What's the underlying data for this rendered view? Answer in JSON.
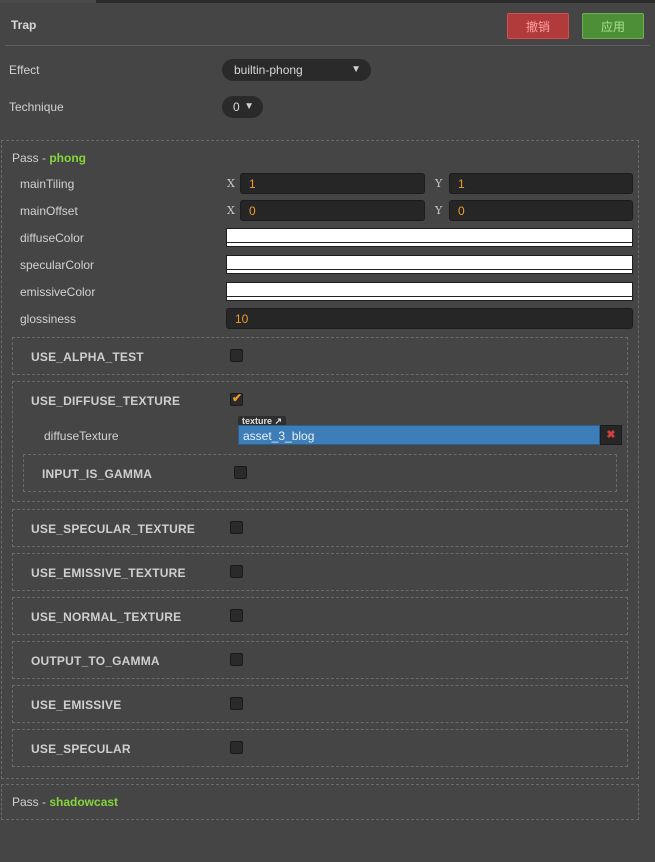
{
  "header": {
    "title": "Trap",
    "revert_label": "撤销",
    "apply_label": "应用"
  },
  "props": {
    "effect_label": "Effect",
    "effect_value": "builtin-phong",
    "technique_label": "Technique",
    "technique_value": "0"
  },
  "passes": [
    {
      "prefix": "Pass - ",
      "name": "phong",
      "props": {
        "mainTiling": {
          "label": "mainTiling",
          "x_axis": "X",
          "x": "1",
          "y_axis": "Y",
          "y": "1"
        },
        "mainOffset": {
          "label": "mainOffset",
          "x_axis": "X",
          "x": "0",
          "y_axis": "Y",
          "y": "0"
        },
        "diffuseColor": {
          "label": "diffuseColor",
          "color": "#ffffff"
        },
        "specularColor": {
          "label": "specularColor",
          "color": "#ffffff"
        },
        "emissiveColor": {
          "label": "emissiveColor",
          "color": "#ffffff"
        },
        "glossiness": {
          "label": "glossiness",
          "value": "10"
        }
      },
      "defines": [
        {
          "label": "USE_ALPHA_TEST",
          "checked": false
        },
        {
          "label": "USE_DIFFUSE_TEXTURE",
          "checked": true,
          "sub": {
            "diffuseTexture_label": "diffuseTexture",
            "asset_type": "texture",
            "asset_value": "asset_3_blog",
            "inner_define": {
              "label": "INPUT_IS_GAMMA",
              "checked": false
            }
          }
        },
        {
          "label": "USE_SPECULAR_TEXTURE",
          "checked": false
        },
        {
          "label": "USE_EMISSIVE_TEXTURE",
          "checked": false
        },
        {
          "label": "USE_NORMAL_TEXTURE",
          "checked": false
        },
        {
          "label": "OUTPUT_TO_GAMMA",
          "checked": false
        },
        {
          "label": "USE_EMISSIVE",
          "checked": false
        },
        {
          "label": "USE_SPECULAR",
          "checked": false
        }
      ]
    },
    {
      "prefix": "Pass - ",
      "name": "shadowcast"
    }
  ],
  "colors": {
    "accent_orange": "#f09a2a",
    "pass_green": "#84d63c",
    "asset_blue": "#3d7eb8"
  },
  "icons": {
    "dropdown": "triangle-down-icon",
    "check": "check-icon",
    "clear": "x-icon",
    "link": "external-link-icon"
  }
}
